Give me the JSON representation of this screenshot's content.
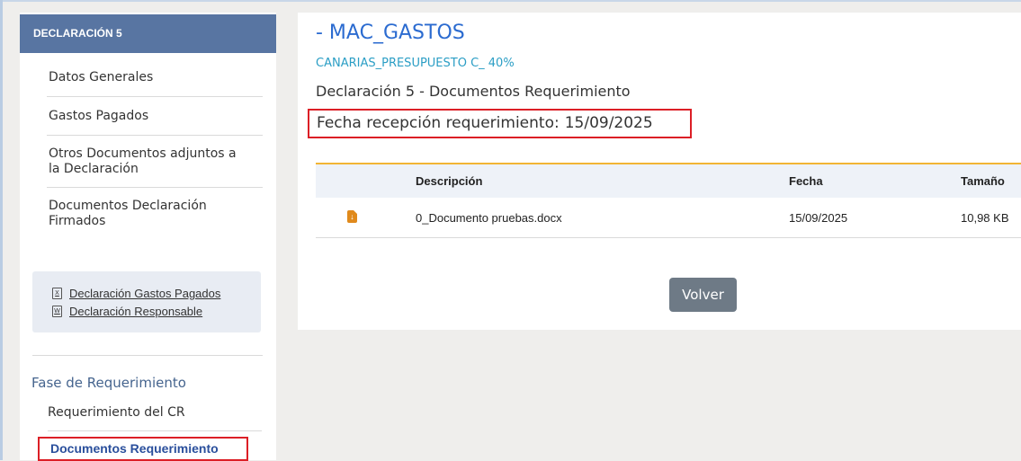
{
  "sidebar": {
    "header": "DECLARACIÓN 5",
    "items": [
      {
        "label": "Datos Generales"
      },
      {
        "label": "Gastos Pagados"
      },
      {
        "label_line1": "Otros Documentos adjuntos a",
        "label_line2": "la Declaración"
      },
      {
        "label_line1": "Documentos Declaración",
        "label_line2": "Firmados"
      }
    ],
    "doc_links": [
      {
        "label": "Declaración Gastos Pagados",
        "icon": "excel-file-icon",
        "icon_glyph": "X"
      },
      {
        "label": "Declaración Responsable",
        "icon": "word-file-icon",
        "icon_glyph": "W"
      }
    ],
    "phase_title": "Fase de Requerimiento",
    "phase_items": [
      {
        "label": "Requerimiento del CR"
      },
      {
        "label": "Documentos Requerimiento"
      }
    ]
  },
  "main": {
    "title": "- MAC_GASTOS",
    "subtitle": "CANARIAS_PRESUPUESTO C_ 40%",
    "heading": "Declaración 5 - Documentos Requerimiento",
    "fecha_label": "Fecha recepción requerimiento:",
    "fecha_value": "15/09/2025",
    "table": {
      "headers": {
        "descripcion": "Descripción",
        "fecha": "Fecha",
        "tamano": "Tamaño"
      },
      "rows": [
        {
          "icon": "download-file-icon",
          "descripcion": "0_Documento pruebas.docx",
          "fecha": "15/09/2025",
          "tamano": "10,98 KB"
        }
      ]
    },
    "volver_label": "Volver"
  },
  "colors": {
    "sidebar_header": "#5875a2",
    "title": "#2b6bd0",
    "subtitle": "#2b9ec5",
    "highlight_border": "#dc1f26",
    "table_accent": "#f2b534",
    "active_item": "#2a4f9c",
    "button": "#6e7a86",
    "file_icon": "#e08a1c"
  }
}
